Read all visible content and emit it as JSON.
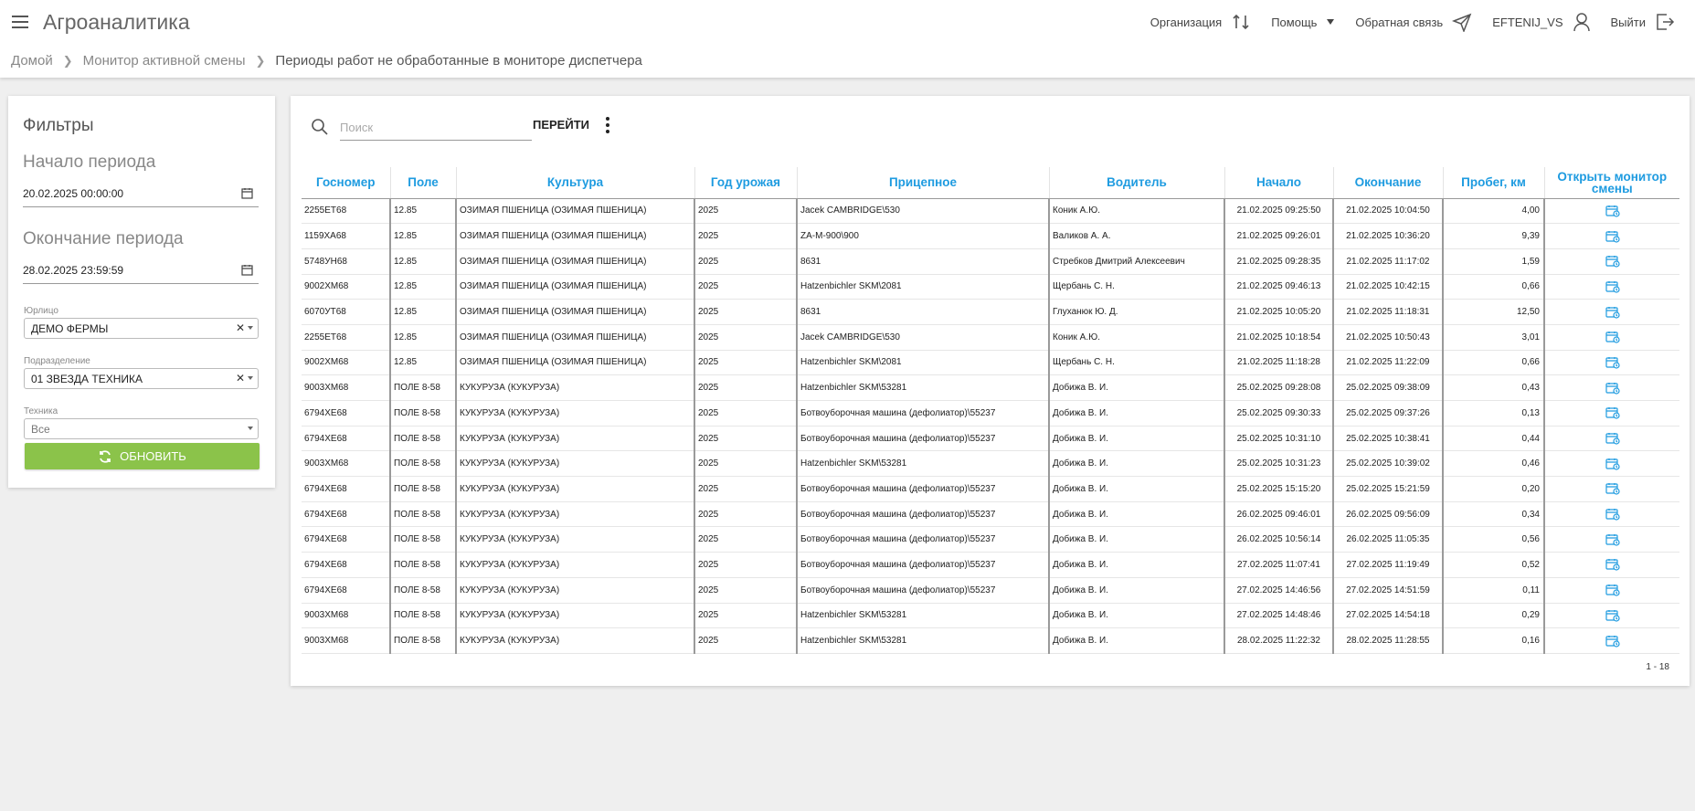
{
  "app": {
    "title": "Агроаналитика"
  },
  "topnav": {
    "organization": "Организация",
    "help": "Помощь",
    "feedback": "Обратная связь",
    "user": "EFTENIJ_VS",
    "logout": "Выйти"
  },
  "breadcrumb": {
    "home": "Домой",
    "monitor": "Монитор активной смены",
    "current": "Периоды работ не обработанные в мониторе диспетчера"
  },
  "filters": {
    "title": "Фильтры",
    "start_label": "Начало периода",
    "start_value": "20.02.2025 00:00:00",
    "end_label": "Окончание периода",
    "end_value": "28.02.2025 23:59:59",
    "entity_label": "Юрлицо",
    "entity_value": "ДЕМО ФЕРМЫ",
    "division_label": "Подразделение",
    "division_value": "01 ЗВЕЗДА ТЕХНИКА",
    "equipment_label": "Техника",
    "equipment_value": "Все",
    "refresh_label": "ОБНОВИТЬ"
  },
  "search": {
    "placeholder": "Поиск",
    "go_label": "ПЕРЕЙТИ"
  },
  "table": {
    "headers": {
      "plate": "Госномер",
      "field": "Поле",
      "crop": "Культура",
      "year": "Год урожая",
      "trailer": "Прицепное",
      "driver": "Водитель",
      "start": "Начало",
      "end": "Окончание",
      "mileage": "Пробег, км",
      "open": "Открыть монитор смены"
    },
    "rows": [
      {
        "plate": "2255ЕТ68",
        "field": "12.85",
        "crop": "ОЗИМАЯ ПШЕНИЦА (ОЗИМАЯ ПШЕНИЦА)",
        "year": "2025",
        "trailer": "Jacek CAMBRIDGE\\530",
        "driver": "Коник А.Ю.",
        "start": "21.02.2025 09:25:50",
        "end": "21.02.2025 10:04:50",
        "mileage": "4,00"
      },
      {
        "plate": "1159ХА68",
        "field": "12.85",
        "crop": "ОЗИМАЯ ПШЕНИЦА (ОЗИМАЯ ПШЕНИЦА)",
        "year": "2025",
        "trailer": "ZA-M-900\\900",
        "driver": "Валиков А. А.",
        "start": "21.02.2025 09:26:01",
        "end": "21.02.2025 10:36:20",
        "mileage": "9,39"
      },
      {
        "plate": "5748УН68",
        "field": "12.85",
        "crop": "ОЗИМАЯ ПШЕНИЦА (ОЗИМАЯ ПШЕНИЦА)",
        "year": "2025",
        "trailer": "8631",
        "driver": "Стребков Дмитрий Алексеевич",
        "start": "21.02.2025 09:28:35",
        "end": "21.02.2025 11:17:02",
        "mileage": "1,59"
      },
      {
        "plate": "9002ХМ68",
        "field": "12.85",
        "crop": "ОЗИМАЯ ПШЕНИЦА (ОЗИМАЯ ПШЕНИЦА)",
        "year": "2025",
        "trailer": "Hatzenbichler SKM\\2081",
        "driver": "Щербань С. Н.",
        "start": "21.02.2025 09:46:13",
        "end": "21.02.2025 10:42:15",
        "mileage": "0,66"
      },
      {
        "plate": "6070УТ68",
        "field": "12.85",
        "crop": "ОЗИМАЯ ПШЕНИЦА (ОЗИМАЯ ПШЕНИЦА)",
        "year": "2025",
        "trailer": "8631",
        "driver": "Глуханюк Ю. Д.",
        "start": "21.02.2025 10:05:20",
        "end": "21.02.2025 11:18:31",
        "mileage": "12,50"
      },
      {
        "plate": "2255ЕТ68",
        "field": "12.85",
        "crop": "ОЗИМАЯ ПШЕНИЦА (ОЗИМАЯ ПШЕНИЦА)",
        "year": "2025",
        "trailer": "Jacek CAMBRIDGE\\530",
        "driver": "Коник А.Ю.",
        "start": "21.02.2025 10:18:54",
        "end": "21.02.2025 10:50:43",
        "mileage": "3,01"
      },
      {
        "plate": "9002ХМ68",
        "field": "12.85",
        "crop": "ОЗИМАЯ ПШЕНИЦА (ОЗИМАЯ ПШЕНИЦА)",
        "year": "2025",
        "trailer": "Hatzenbichler SKM\\2081",
        "driver": "Щербань С. Н.",
        "start": "21.02.2025 11:18:28",
        "end": "21.02.2025 11:22:09",
        "mileage": "0,66"
      },
      {
        "plate": "9003ХМ68",
        "field": "ПОЛЕ 8-58",
        "crop": "КУКУРУЗА (КУКУРУЗА)",
        "year": "2025",
        "trailer": "Hatzenbichler SKM\\53281",
        "driver": "Добижа В. И.",
        "start": "25.02.2025 09:28:08",
        "end": "25.02.2025 09:38:09",
        "mileage": "0,43"
      },
      {
        "plate": "6794ХЕ68",
        "field": "ПОЛЕ 8-58",
        "crop": "КУКУРУЗА (КУКУРУЗА)",
        "year": "2025",
        "trailer": "Ботвоуборочная машина (дефолиатор)\\55237",
        "driver": "Добижа В. И.",
        "start": "25.02.2025 09:30:33",
        "end": "25.02.2025 09:37:26",
        "mileage": "0,13"
      },
      {
        "plate": "6794ХЕ68",
        "field": "ПОЛЕ 8-58",
        "crop": "КУКУРУЗА (КУКУРУЗА)",
        "year": "2025",
        "trailer": "Ботвоуборочная машина (дефолиатор)\\55237",
        "driver": "Добижа В. И.",
        "start": "25.02.2025 10:31:10",
        "end": "25.02.2025 10:38:41",
        "mileage": "0,44"
      },
      {
        "plate": "9003ХМ68",
        "field": "ПОЛЕ 8-58",
        "crop": "КУКУРУЗА (КУКУРУЗА)",
        "year": "2025",
        "trailer": "Hatzenbichler SKM\\53281",
        "driver": "Добижа В. И.",
        "start": "25.02.2025 10:31:23",
        "end": "25.02.2025 10:39:02",
        "mileage": "0,46"
      },
      {
        "plate": "6794ХЕ68",
        "field": "ПОЛЕ 8-58",
        "crop": "КУКУРУЗА (КУКУРУЗА)",
        "year": "2025",
        "trailer": "Ботвоуборочная машина (дефолиатор)\\55237",
        "driver": "Добижа В. И.",
        "start": "25.02.2025 15:15:20",
        "end": "25.02.2025 15:21:59",
        "mileage": "0,20"
      },
      {
        "plate": "6794ХЕ68",
        "field": "ПОЛЕ 8-58",
        "crop": "КУКУРУЗА (КУКУРУЗА)",
        "year": "2025",
        "trailer": "Ботвоуборочная машина (дефолиатор)\\55237",
        "driver": "Добижа В. И.",
        "start": "26.02.2025 09:46:01",
        "end": "26.02.2025 09:56:09",
        "mileage": "0,34"
      },
      {
        "plate": "6794ХЕ68",
        "field": "ПОЛЕ 8-58",
        "crop": "КУКУРУЗА (КУКУРУЗА)",
        "year": "2025",
        "trailer": "Ботвоуборочная машина (дефолиатор)\\55237",
        "driver": "Добижа В. И.",
        "start": "26.02.2025 10:56:14",
        "end": "26.02.2025 11:05:35",
        "mileage": "0,56"
      },
      {
        "plate": "6794ХЕ68",
        "field": "ПОЛЕ 8-58",
        "crop": "КУКУРУЗА (КУКУРУЗА)",
        "year": "2025",
        "trailer": "Ботвоуборочная машина (дефолиатор)\\55237",
        "driver": "Добижа В. И.",
        "start": "27.02.2025 11:07:41",
        "end": "27.02.2025 11:19:49",
        "mileage": "0,52"
      },
      {
        "plate": "6794ХЕ68",
        "field": "ПОЛЕ 8-58",
        "crop": "КУКУРУЗА (КУКУРУЗА)",
        "year": "2025",
        "trailer": "Ботвоуборочная машина (дефолиатор)\\55237",
        "driver": "Добижа В. И.",
        "start": "27.02.2025 14:46:56",
        "end": "27.02.2025 14:51:59",
        "mileage": "0,11"
      },
      {
        "plate": "9003ХМ68",
        "field": "ПОЛЕ 8-58",
        "crop": "КУКУРУЗА (КУКУРУЗА)",
        "year": "2025",
        "trailer": "Hatzenbichler SKM\\53281",
        "driver": "Добижа В. И.",
        "start": "27.02.2025 14:48:46",
        "end": "27.02.2025 14:54:18",
        "mileage": "0,29"
      },
      {
        "plate": "9003ХМ68",
        "field": "ПОЛЕ 8-58",
        "crop": "КУКУРУЗА (КУКУРУЗА)",
        "year": "2025",
        "trailer": "Hatzenbichler SKM\\53281",
        "driver": "Добижа В. И.",
        "start": "28.02.2025 11:22:32",
        "end": "28.02.2025 11:28:55",
        "mileage": "0,16"
      }
    ]
  },
  "pager": {
    "range": "1 - 18"
  },
  "colors": {
    "accent": "#1e9be0",
    "refresh": "#8bc34a"
  }
}
